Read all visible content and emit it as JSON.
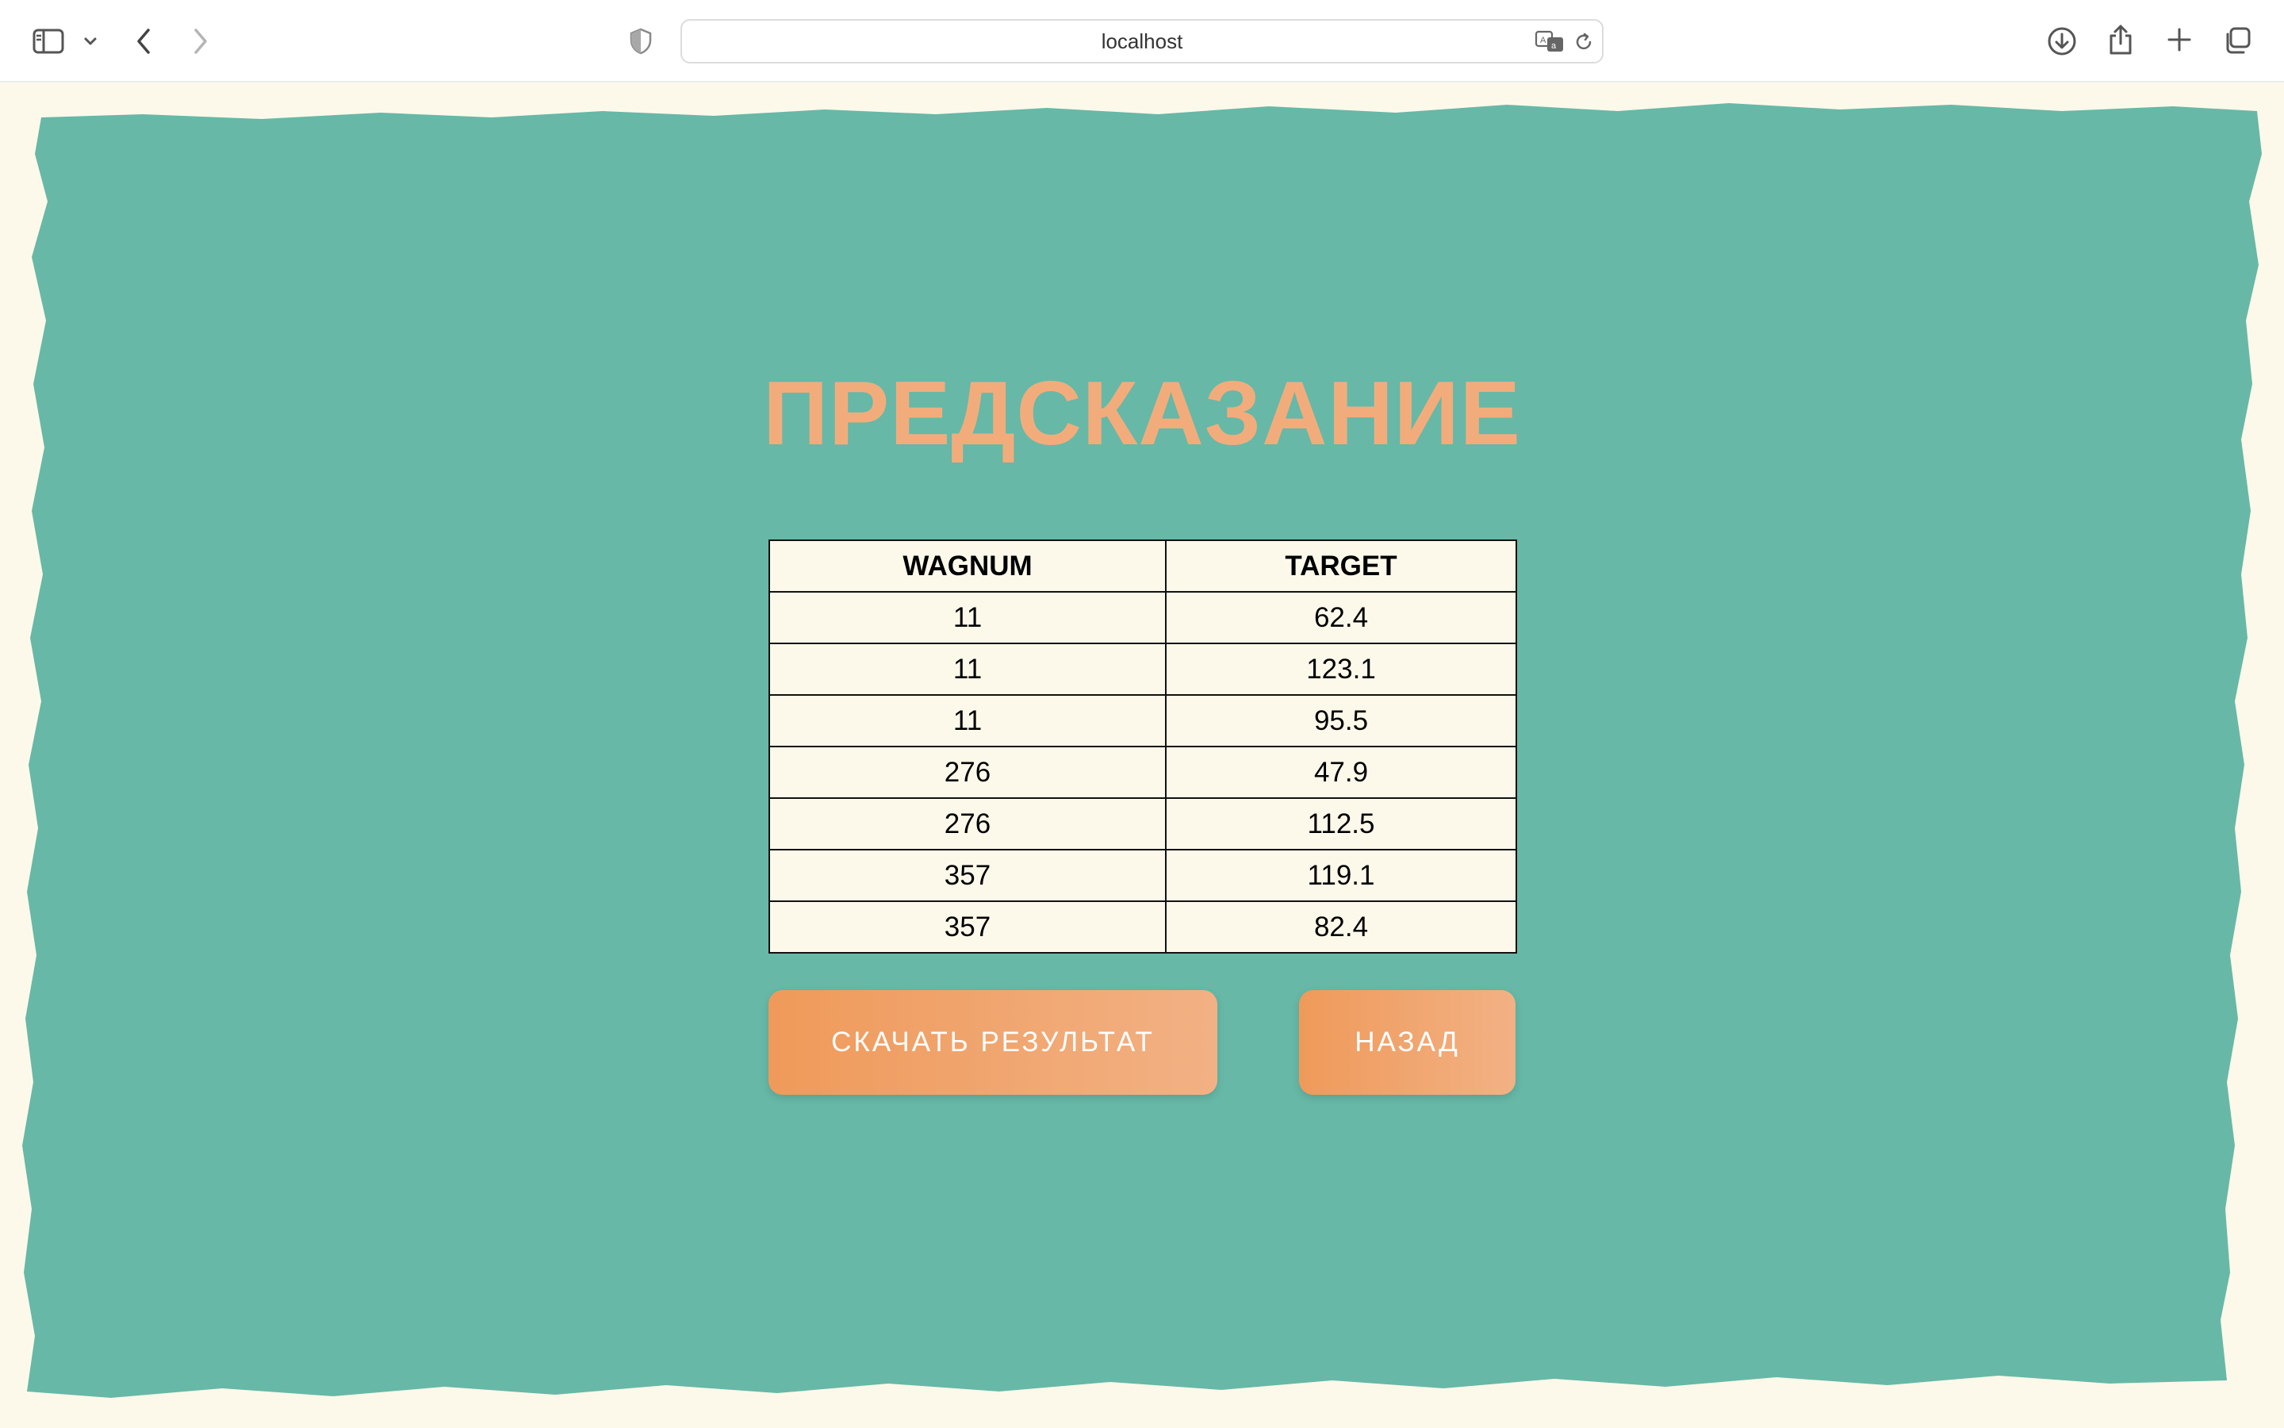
{
  "browser": {
    "url": "localhost"
  },
  "page": {
    "title": "ПРЕДСКАЗАНИЕ",
    "table": {
      "columns": [
        "WAGNUM",
        "TARGET"
      ],
      "rows": [
        [
          "11",
          "62.4"
        ],
        [
          "11",
          "123.1"
        ],
        [
          "11",
          "95.5"
        ],
        [
          "276",
          "47.9"
        ],
        [
          "276",
          "112.5"
        ],
        [
          "357",
          "119.1"
        ],
        [
          "357",
          "82.4"
        ]
      ]
    },
    "buttons": {
      "download_label": "СКАЧАТЬ РЕЗУЛЬТАТ",
      "back_label": "НАЗАД"
    }
  },
  "colors": {
    "teal": "#67b8a7",
    "cream": "#fdf9ea",
    "accent_orange": "#f2ac7c",
    "button_start": "#ef9a5a",
    "button_end": "#f2b184"
  },
  "icons": [
    "sidebar-icon",
    "chevron-down-icon",
    "back-icon",
    "forward-icon",
    "privacy-shield-icon",
    "translate-icon",
    "reload-icon",
    "download-icon",
    "share-icon",
    "plus-icon",
    "tabs-overview-icon"
  ]
}
